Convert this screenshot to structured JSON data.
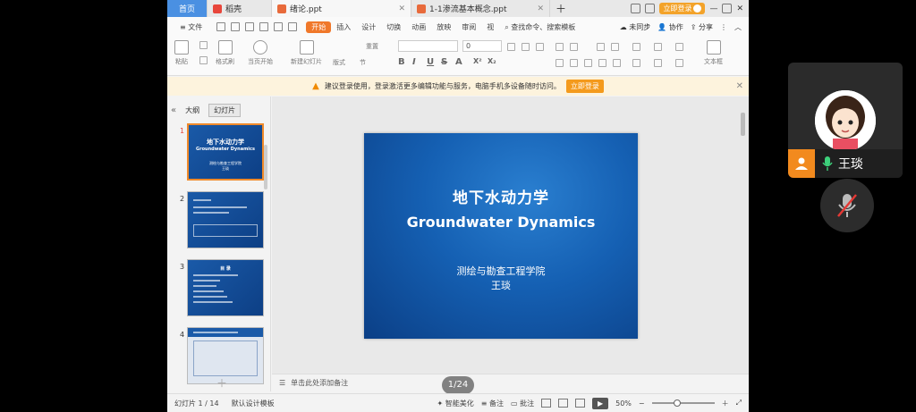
{
  "tabs": [
    {
      "label": "首页"
    },
    {
      "label": "稻壳"
    },
    {
      "label": "绪论.ppt"
    },
    {
      "label": "1-1渗流基本概念.ppt"
    }
  ],
  "top_right": {
    "login": "立即登录"
  },
  "menu": {
    "file": "≡ 文件",
    "items": [
      "开始",
      "插入",
      "设计",
      "切换",
      "动画",
      "放映",
      "审阅",
      "视"
    ],
    "search_placeholder": "查找命令、搜索模板",
    "sync": "未同步",
    "collab": "协作",
    "share": "分享"
  },
  "ribbon": {
    "paste": "粘贴",
    "format_painter": "格式刷",
    "play_from_current": "当页开始",
    "new_slide": "新建幻灯片",
    "layout": "版式",
    "section": "节",
    "reset": "重置",
    "font_size": "0",
    "textbox": "文本框"
  },
  "notice": {
    "text": "建议登录使用，登录激活更多编辑功能与服务，电脑手机多设备随时访问。",
    "button": "立即登录"
  },
  "left_panel": {
    "tab_outline": "大纲",
    "tab_slides": "幻灯片",
    "thumbnails": [
      {
        "num": "1",
        "title": "地下水动力学",
        "subtitle": "Groundwater Dynamics",
        "info": "测绘与勘查工程学院\n王琰"
      },
      {
        "num": "2"
      },
      {
        "num": "3",
        "title": "目 录"
      },
      {
        "num": "4"
      }
    ]
  },
  "slide": {
    "title_cn": "地下水动力学",
    "title_en": "Groundwater Dynamics",
    "department": "测绘与勘查工程学院",
    "author": "王琰"
  },
  "notes_placeholder": "单击此处添加备注",
  "page_badge": "1/24",
  "status": {
    "slide_count": "幻灯片 1 / 14",
    "template": "默认设计模板",
    "beautify": "智能美化",
    "notes": "备注",
    "comments": "批注",
    "zoom": "50%"
  },
  "call": {
    "participant": "王琰"
  }
}
